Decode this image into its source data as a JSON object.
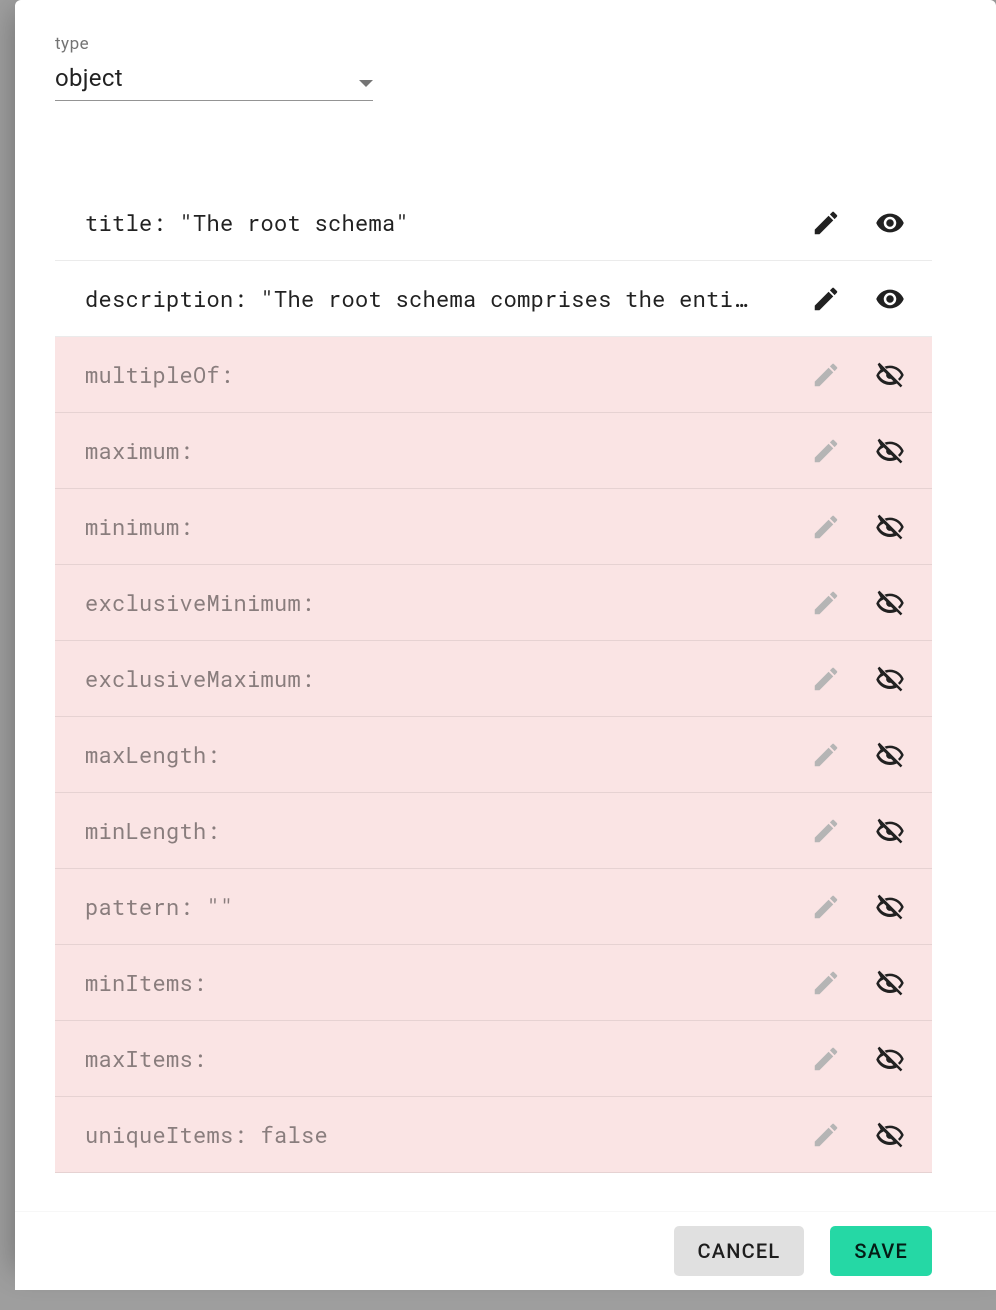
{
  "type_field": {
    "label": "type",
    "value": "object"
  },
  "rows": [
    {
      "label": "title: \"The root schema\"",
      "active": true
    },
    {
      "label": "description: \"The root schema comprises the enti…",
      "active": true
    },
    {
      "label": "multipleOf:",
      "active": false
    },
    {
      "label": "maximum:",
      "active": false
    },
    {
      "label": "minimum:",
      "active": false
    },
    {
      "label": "exclusiveMinimum:",
      "active": false
    },
    {
      "label": "exclusiveMaximum:",
      "active": false
    },
    {
      "label": "maxLength:",
      "active": false
    },
    {
      "label": "minLength:",
      "active": false
    },
    {
      "label": "pattern: \"\"",
      "active": false
    },
    {
      "label": "minItems:",
      "active": false
    },
    {
      "label": "maxItems:",
      "active": false
    },
    {
      "label": "uniqueItems: false",
      "active": false
    }
  ],
  "actions": {
    "cancel": "CANCEL",
    "save": "SAVE"
  }
}
